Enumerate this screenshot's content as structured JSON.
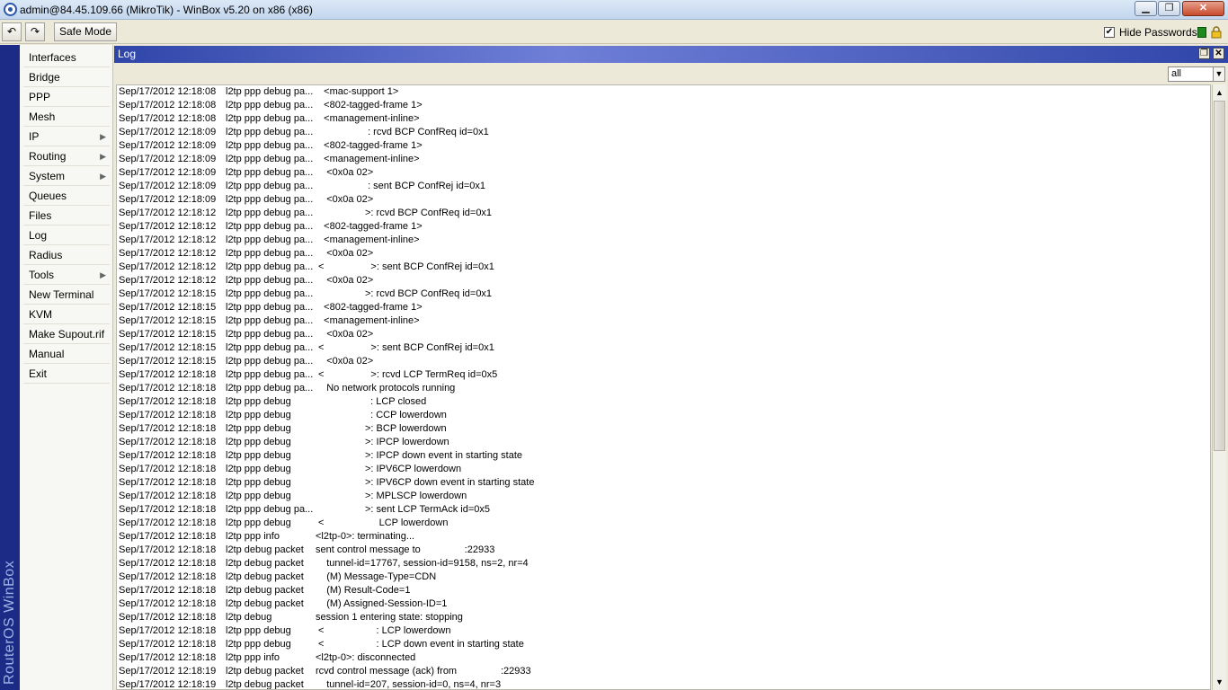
{
  "window": {
    "title": "admin@84.45.109.66 (MikroTik) - WinBox v5.20 on x86 (x86)",
    "min_glyph": "▁",
    "max_glyph": "❐",
    "close_glyph": "✕"
  },
  "toolbar": {
    "undo_glyph": "↶",
    "redo_glyph": "↷",
    "safe_mode_label": "Safe Mode",
    "hide_passwords_label": "Hide Passwords",
    "hide_passwords_checked": "✔"
  },
  "brand": "RouterOS WinBox",
  "sidebar": {
    "items": [
      {
        "label": "Interfaces",
        "arrow": ""
      },
      {
        "label": "Bridge",
        "arrow": ""
      },
      {
        "label": "PPP",
        "arrow": ""
      },
      {
        "label": "Mesh",
        "arrow": ""
      },
      {
        "label": "IP",
        "arrow": "▶"
      },
      {
        "label": "Routing",
        "arrow": "▶"
      },
      {
        "label": "System",
        "arrow": "▶"
      },
      {
        "label": "Queues",
        "arrow": ""
      },
      {
        "label": "Files",
        "arrow": ""
      },
      {
        "label": "Log",
        "arrow": ""
      },
      {
        "label": "Radius",
        "arrow": ""
      },
      {
        "label": "Tools",
        "arrow": "▶"
      },
      {
        "label": "New Terminal",
        "arrow": ""
      },
      {
        "label": "KVM",
        "arrow": ""
      },
      {
        "label": "Make Supout.rif",
        "arrow": ""
      },
      {
        "label": "Manual",
        "arrow": ""
      },
      {
        "label": "Exit",
        "arrow": ""
      }
    ]
  },
  "log": {
    "title": "Log",
    "filter_value": "all",
    "filter_arrow": "▼",
    "scroll_up": "▲",
    "scroll_down": "▼",
    "rows": [
      {
        "time": "Sep/17/2012 12:18:08",
        "topic": "l2tp ppp debug pa...",
        "msg": "   <mac-support 1>"
      },
      {
        "time": "Sep/17/2012 12:18:08",
        "topic": "l2tp ppp debug pa...",
        "msg": "   <802-tagged-frame 1>"
      },
      {
        "time": "Sep/17/2012 12:18:08",
        "topic": "l2tp ppp debug pa...",
        "msg": "   <management-inline>"
      },
      {
        "time": "Sep/17/2012 12:18:09",
        "topic": "l2tp ppp debug pa...",
        "msg": "                   : rcvd BCP ConfReq id=0x1"
      },
      {
        "time": "Sep/17/2012 12:18:09",
        "topic": "l2tp ppp debug pa...",
        "msg": "   <802-tagged-frame 1>"
      },
      {
        "time": "Sep/17/2012 12:18:09",
        "topic": "l2tp ppp debug pa...",
        "msg": "   <management-inline>"
      },
      {
        "time": "Sep/17/2012 12:18:09",
        "topic": "l2tp ppp debug pa...",
        "msg": "    <0x0a 02>"
      },
      {
        "time": "Sep/17/2012 12:18:09",
        "topic": "l2tp ppp debug pa...",
        "msg": "                   : sent BCP ConfRej id=0x1"
      },
      {
        "time": "Sep/17/2012 12:18:09",
        "topic": "l2tp ppp debug pa...",
        "msg": "    <0x0a 02>"
      },
      {
        "time": "Sep/17/2012 12:18:12",
        "topic": "l2tp ppp debug pa...",
        "msg": "                  >: rcvd BCP ConfReq id=0x1"
      },
      {
        "time": "Sep/17/2012 12:18:12",
        "topic": "l2tp ppp debug pa...",
        "msg": "   <802-tagged-frame 1>"
      },
      {
        "time": "Sep/17/2012 12:18:12",
        "topic": "l2tp ppp debug pa...",
        "msg": "   <management-inline>"
      },
      {
        "time": "Sep/17/2012 12:18:12",
        "topic": "l2tp ppp debug pa...",
        "msg": "    <0x0a 02>"
      },
      {
        "time": "Sep/17/2012 12:18:12",
        "topic": "l2tp ppp debug pa...",
        "msg": " <                 >: sent BCP ConfRej id=0x1"
      },
      {
        "time": "Sep/17/2012 12:18:12",
        "topic": "l2tp ppp debug pa...",
        "msg": "    <0x0a 02>"
      },
      {
        "time": "Sep/17/2012 12:18:15",
        "topic": "l2tp ppp debug pa...",
        "msg": "                  >: rcvd BCP ConfReq id=0x1"
      },
      {
        "time": "Sep/17/2012 12:18:15",
        "topic": "l2tp ppp debug pa...",
        "msg": "   <802-tagged-frame 1>"
      },
      {
        "time": "Sep/17/2012 12:18:15",
        "topic": "l2tp ppp debug pa...",
        "msg": "   <management-inline>"
      },
      {
        "time": "Sep/17/2012 12:18:15",
        "topic": "l2tp ppp debug pa...",
        "msg": "    <0x0a 02>"
      },
      {
        "time": "Sep/17/2012 12:18:15",
        "topic": "l2tp ppp debug pa...",
        "msg": " <                 >: sent BCP ConfRej id=0x1"
      },
      {
        "time": "Sep/17/2012 12:18:15",
        "topic": "l2tp ppp debug pa...",
        "msg": "    <0x0a 02>"
      },
      {
        "time": "Sep/17/2012 12:18:18",
        "topic": "l2tp ppp debug pa...",
        "msg": " <                 >: rcvd LCP TermReq id=0x5"
      },
      {
        "time": "Sep/17/2012 12:18:18",
        "topic": "l2tp ppp debug pa...",
        "msg": "    No network protocols running"
      },
      {
        "time": "Sep/17/2012 12:18:18",
        "topic": "l2tp ppp debug",
        "msg": "                    : LCP closed"
      },
      {
        "time": "Sep/17/2012 12:18:18",
        "topic": "l2tp ppp debug",
        "msg": "                    : CCP lowerdown"
      },
      {
        "time": "Sep/17/2012 12:18:18",
        "topic": "l2tp ppp debug",
        "msg": "                  >: BCP lowerdown"
      },
      {
        "time": "Sep/17/2012 12:18:18",
        "topic": "l2tp ppp debug",
        "msg": "                  >: IPCP lowerdown"
      },
      {
        "time": "Sep/17/2012 12:18:18",
        "topic": "l2tp ppp debug",
        "msg": "                  >: IPCP down event in starting state"
      },
      {
        "time": "Sep/17/2012 12:18:18",
        "topic": "l2tp ppp debug",
        "msg": "                  >: IPV6CP lowerdown"
      },
      {
        "time": "Sep/17/2012 12:18:18",
        "topic": "l2tp ppp debug",
        "msg": "                  >: IPV6CP down event in starting state"
      },
      {
        "time": "Sep/17/2012 12:18:18",
        "topic": "l2tp ppp debug",
        "msg": "                  >: MPLSCP lowerdown"
      },
      {
        "time": "Sep/17/2012 12:18:18",
        "topic": "l2tp ppp debug pa...",
        "msg": "                  >: sent LCP TermAck id=0x5"
      },
      {
        "time": "Sep/17/2012 12:18:18",
        "topic": "l2tp ppp debug",
        "msg": " <                    LCP lowerdown"
      },
      {
        "time": "Sep/17/2012 12:18:18",
        "topic": "l2tp ppp info",
        "msg": "<l2tp-0>: terminating..."
      },
      {
        "time": "Sep/17/2012 12:18:18",
        "topic": "l2tp debug packet",
        "msg": "sent control message to                :22933"
      },
      {
        "time": "Sep/17/2012 12:18:18",
        "topic": "l2tp debug packet",
        "msg": "    tunnel-id=17767, session-id=9158, ns=2, nr=4"
      },
      {
        "time": "Sep/17/2012 12:18:18",
        "topic": "l2tp debug packet",
        "msg": "    (M) Message-Type=CDN"
      },
      {
        "time": "Sep/17/2012 12:18:18",
        "topic": "l2tp debug packet",
        "msg": "    (M) Result-Code=1"
      },
      {
        "time": "Sep/17/2012 12:18:18",
        "topic": "l2tp debug packet",
        "msg": "    (M) Assigned-Session-ID=1"
      },
      {
        "time": "Sep/17/2012 12:18:18",
        "topic": "l2tp debug",
        "msg": "session 1 entering state: stopping"
      },
      {
        "time": "Sep/17/2012 12:18:18",
        "topic": "l2tp ppp debug",
        "msg": " <                   : LCP lowerdown"
      },
      {
        "time": "Sep/17/2012 12:18:18",
        "topic": "l2tp ppp debug",
        "msg": " <                   : LCP down event in starting state"
      },
      {
        "time": "Sep/17/2012 12:18:18",
        "topic": "l2tp ppp info",
        "msg": "<l2tp-0>: disconnected"
      },
      {
        "time": "Sep/17/2012 12:18:19",
        "topic": "l2tp debug packet",
        "msg": "rcvd control message (ack) from                :22933"
      },
      {
        "time": "Sep/17/2012 12:18:19",
        "topic": "l2tp debug packet",
        "msg": "    tunnel-id=207, session-id=0, ns=4, nr=3"
      }
    ]
  }
}
